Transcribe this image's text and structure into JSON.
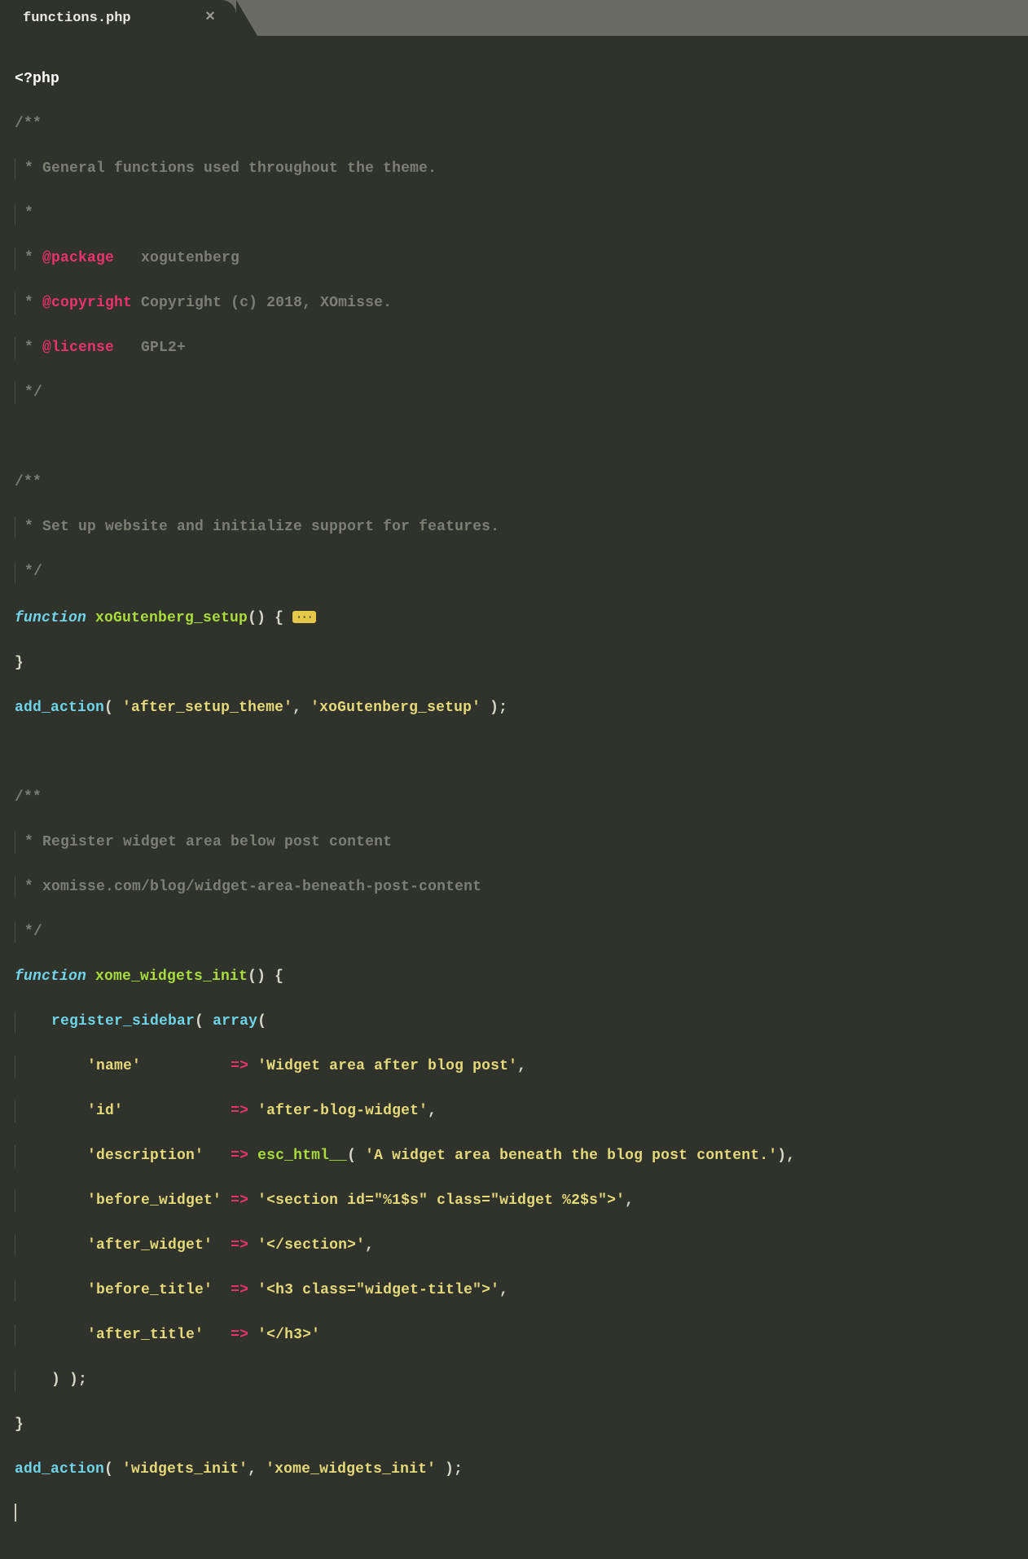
{
  "tab": {
    "filename": "functions.php",
    "close_glyph": "×"
  },
  "code": {
    "php_open": "<?php",
    "doc1": {
      "l1": "/**",
      "l2": " * General functions used throughout the theme.",
      "l3": " *",
      "l4_pre": " * ",
      "l4_tag": "@package",
      "l4_post": "   xogutenberg",
      "l5_pre": " * ",
      "l5_tag": "@copyright",
      "l5_post": " Copyright (c) 2018, XOmisse.",
      "l6_pre": " * ",
      "l6_tag": "@license",
      "l6_post": "   GPL2+",
      "l7": " */"
    },
    "doc2": {
      "l1": "/**",
      "l2": " * Set up website and initialize support for features.",
      "l3": " */"
    },
    "fn1": {
      "kw": "function",
      "name": " xoGutenberg_setup",
      "parens": "()",
      "brace_open": " {",
      "fold": "···",
      "close_brace": "}"
    },
    "action1": {
      "fn": "add_action",
      "open": "( ",
      "arg1": "'after_setup_theme'",
      "comma": ", ",
      "arg2": "'xoGutenberg_setup'",
      "close": " );"
    },
    "doc3": {
      "l1": "/**",
      "l2": " * Register widget area below post content",
      "l3": " * xomisse.com/blog/widget-area-beneath-post-content",
      "l4": " */"
    },
    "fn2": {
      "kw": "function",
      "name": " xome_widgets_init",
      "parens": "()",
      "brace_open": " {"
    },
    "reg": {
      "indent": "    ",
      "fn": "register_sidebar",
      "open": "( ",
      "arr_kw": "array",
      "arr_open": "(",
      "rows": {
        "indent": "        ",
        "r1_k": "'name'",
        "r1_pad": "          ",
        "arrow": "=>",
        "r1_v": " 'Widget area after blog post'",
        "comma": ",",
        "r2_k": "'id'",
        "r2_pad": "            ",
        "r2_v": " 'after-blog-widget'",
        "r3_k": "'description'",
        "r3_pad": "   ",
        "r3_fn": " esc_html__",
        "r3_open": "( ",
        "r3_arg": "'A widget area beneath the blog post content.'",
        "r3_close": ")",
        "r4_k": "'before_widget'",
        "r4_pad": " ",
        "r4_v": " '<section id=\"%1$s\" class=\"widget %2$s\">'",
        "r5_k": "'after_widget'",
        "r5_pad": "  ",
        "r5_v": " '</section>'",
        "r6_k": "'before_title'",
        "r6_pad": "  ",
        "r6_v": " '<h3 class=\"widget-title\">'",
        "r7_k": "'after_title'",
        "r7_pad": "   ",
        "r7_v": " '</h3>'"
      },
      "close_indent": "    ",
      "close": ") );"
    },
    "fn2_close": "}",
    "action2": {
      "fn": "add_action",
      "open": "( ",
      "arg1": "'widgets_init'",
      "comma": ", ",
      "arg2": "'xome_widgets_init'",
      "close": " );"
    }
  }
}
